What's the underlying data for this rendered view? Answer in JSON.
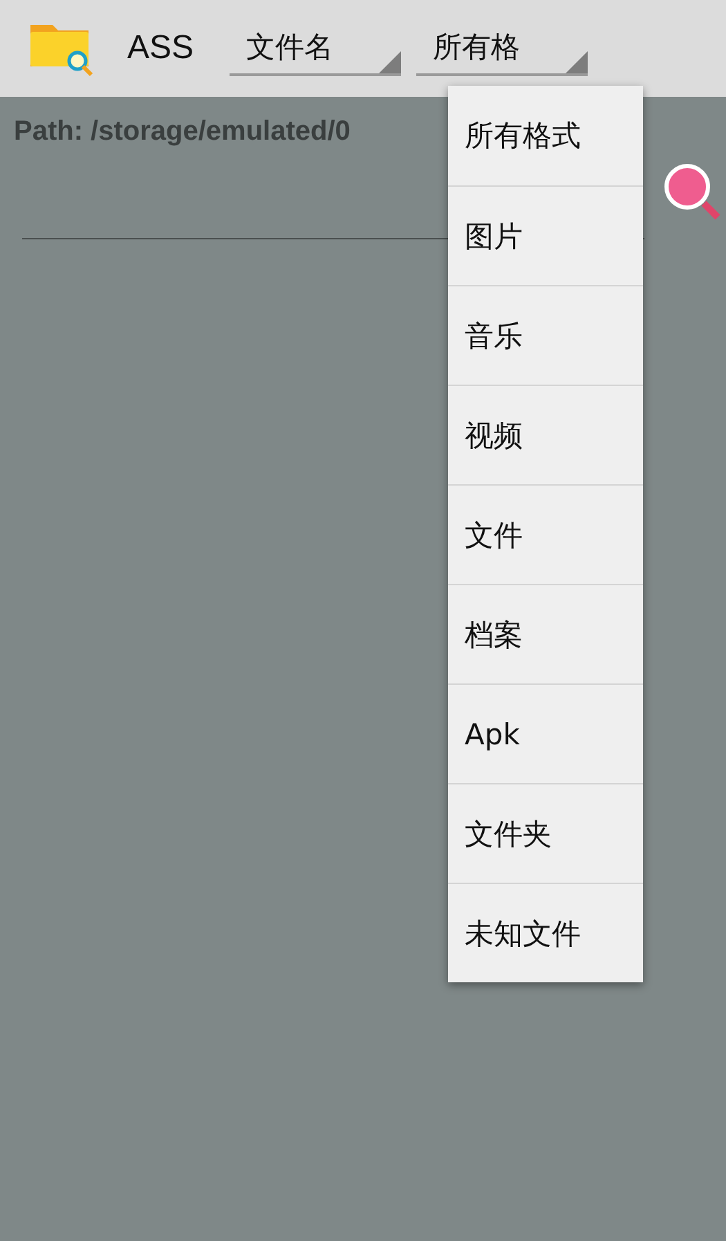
{
  "app_bar": {
    "title": "ASS",
    "spinners": [
      {
        "value": "文件名"
      },
      {
        "value": "所有格"
      }
    ]
  },
  "path": "Path: /storage/emulated/0",
  "dropdown": {
    "items": [
      {
        "label": "所有格式"
      },
      {
        "label": "图片"
      },
      {
        "label": "音乐"
      },
      {
        "label": "视频"
      },
      {
        "label": "文件"
      },
      {
        "label": "档案"
      },
      {
        "label": "Apk"
      },
      {
        "label": "文件夹"
      },
      {
        "label": "未知文件"
      }
    ]
  }
}
